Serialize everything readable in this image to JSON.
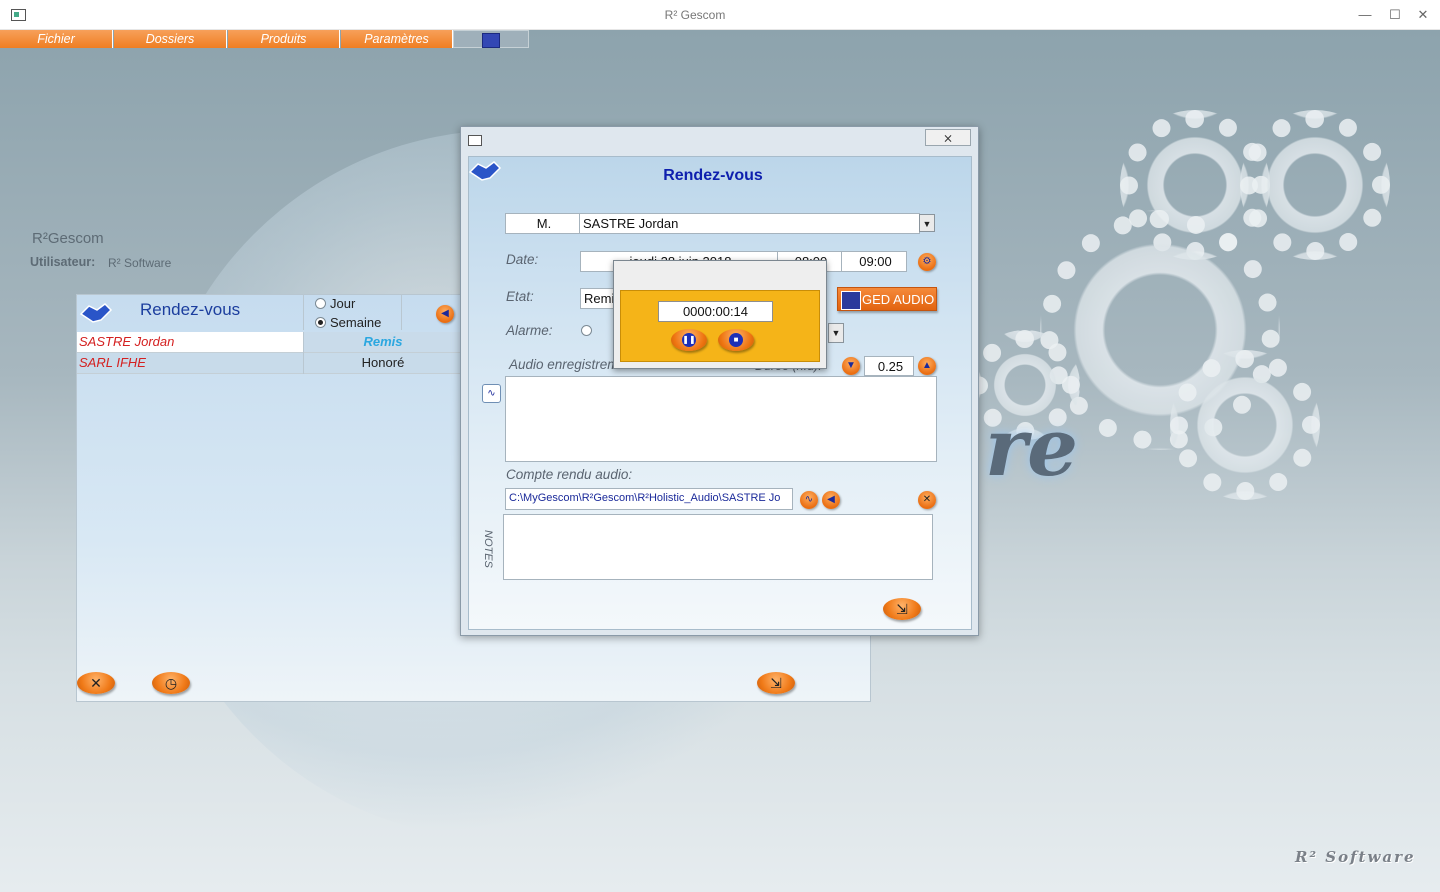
{
  "window": {
    "title": "R² Gescom"
  },
  "menu": {
    "items": [
      "Fichier",
      "Dossiers",
      "Produits",
      "Paramètres"
    ]
  },
  "desktop": {
    "app_name": "R²Gescom",
    "user_label": "Utilisateur:",
    "user_value": "R² Software",
    "brand": "R² Software",
    "big_text": "re"
  },
  "list_panel": {
    "title": "Rendez-vous",
    "radio": [
      {
        "label": "Jour",
        "selected": false
      },
      {
        "label": "Semaine",
        "selected": true
      }
    ],
    "rows": [
      {
        "name": "SASTRE Jordan",
        "status": "Remis"
      },
      {
        "name": "SARL IFHE",
        "status": "Honoré"
      }
    ]
  },
  "dialog": {
    "close": "⨯",
    "title": "Rendez-vous",
    "civility": "M.",
    "client": "SASTRE Jordan",
    "date_label": "Date:",
    "date_value": "jeudi 28 juin 2018",
    "time_start": "08:00",
    "time_end": "09:00",
    "etat_label": "Etat:",
    "etat_value": "Remis",
    "alarme_label": "Alarme:",
    "ged_audio": "GED AUDIO",
    "audio_label": "Audio enregistrement:",
    "duree_label": "Durée (h.d):",
    "duree_value": "0.25",
    "compte_rendu_label": "Compte rendu audio:",
    "audio_path": "C:\\MyGescom\\R²Gescom\\R²Holistic_Audio\\SASTRE Jo",
    "notes_label": "NOTES"
  },
  "recorder": {
    "time": "0000:00:14"
  },
  "colors": {
    "accent_orange": "#ef7e22",
    "title_blue": "#0e1fae",
    "name_red": "#d42020",
    "recorder_bg": "#f5b418"
  }
}
